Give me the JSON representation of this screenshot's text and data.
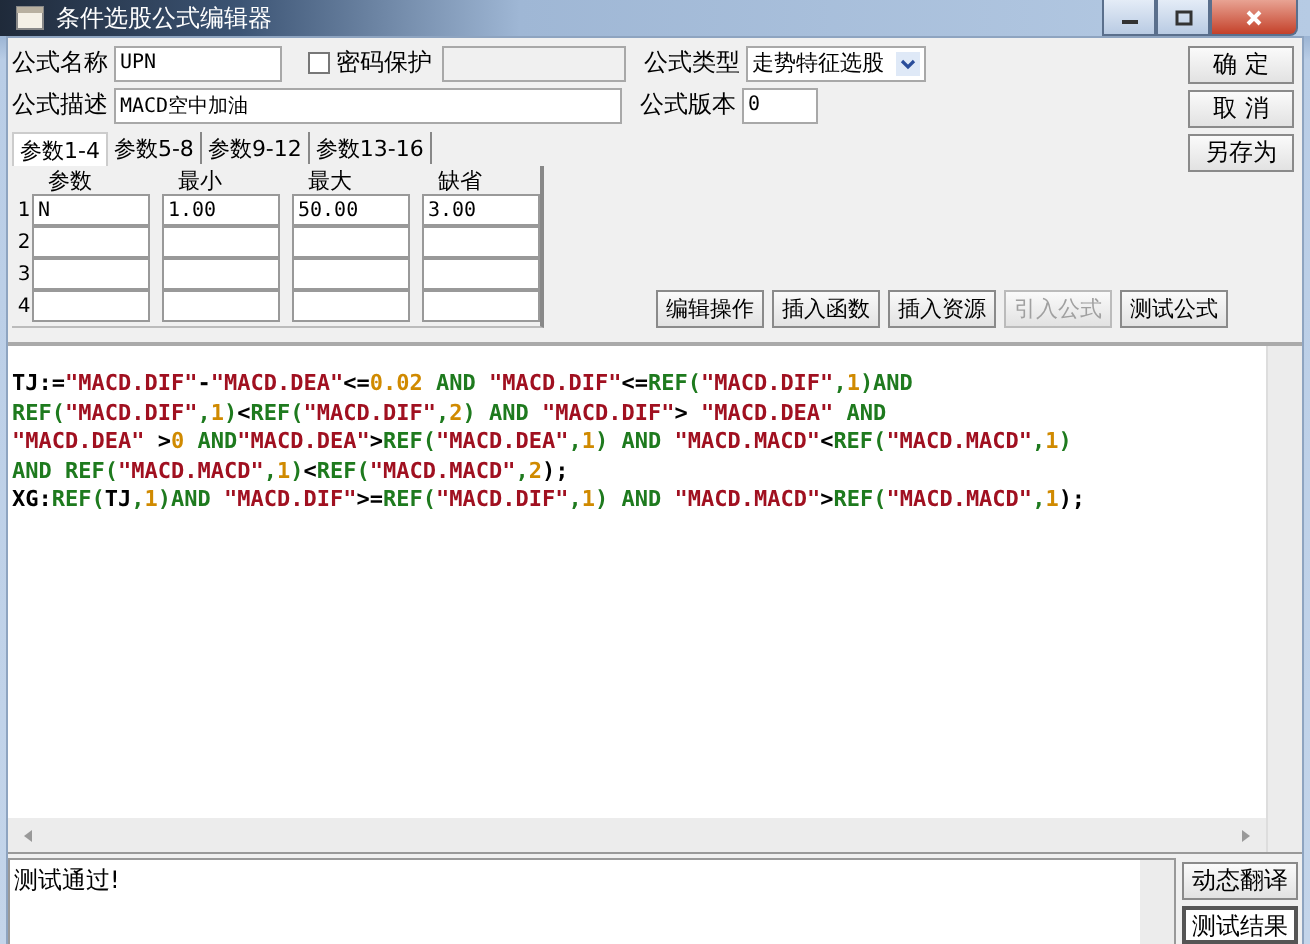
{
  "window": {
    "title": "条件选股公式编辑器"
  },
  "form": {
    "name_label": "公式名称",
    "name": "UPN",
    "password": {
      "label": "密码保护",
      "checked": false
    },
    "type_label": "公式类型",
    "type": "走势特征选股",
    "desc_label": "公式描述",
    "desc": "MACD空中加油",
    "version_label": "公式版本",
    "version": "0"
  },
  "side_buttons": [
    "确 定",
    "取 消",
    "另存为"
  ],
  "param_tabs": [
    {
      "label": "参数1-4",
      "selected": true
    },
    {
      "label": "参数5-8",
      "selected": false
    },
    {
      "label": "参数9-12",
      "selected": false
    },
    {
      "label": "参数13-16",
      "selected": false
    }
  ],
  "params": {
    "columns": [
      "参数",
      "最小",
      "最大",
      "缺省"
    ],
    "rows": [
      {
        "index": "1",
        "values": [
          "N",
          "1.00",
          "50.00",
          "3.00"
        ]
      },
      {
        "index": "2"
      },
      {
        "index": "3"
      },
      {
        "index": "4"
      }
    ]
  },
  "tool_buttons": [
    {
      "label": "编辑操作",
      "disabled": false
    },
    {
      "label": "插入函数",
      "disabled": false
    },
    {
      "label": "插入资源",
      "disabled": false
    },
    {
      "label": "引入公式",
      "disabled": true
    },
    {
      "label": "测试公式",
      "disabled": false
    }
  ],
  "code_lines": [
    [
      {
        "kind": "plain",
        "text": "TJ:="
      },
      {
        "kind": "str",
        "text": "\"MACD.DIF\""
      },
      {
        "kind": "plain",
        "text": "-"
      },
      {
        "kind": "str",
        "text": "\"MACD.DEA\""
      },
      {
        "kind": "plain",
        "text": "<="
      },
      {
        "kind": "num",
        "text": "0.02"
      },
      {
        "kind": "kw",
        "text": " AND "
      },
      {
        "kind": "str",
        "text": "\"MACD.DIF\""
      },
      {
        "kind": "plain",
        "text": "<="
      },
      {
        "kind": "kw",
        "text": "REF("
      },
      {
        "kind": "str",
        "text": "\"MACD.DIF\""
      },
      {
        "kind": "kw",
        "text": ","
      },
      {
        "kind": "num",
        "text": "1"
      },
      {
        "kind": "kw",
        "text": ")AND"
      }
    ],
    [
      {
        "kind": "kw",
        "text": "REF("
      },
      {
        "kind": "str",
        "text": "\"MACD.DIF\""
      },
      {
        "kind": "kw",
        "text": ","
      },
      {
        "kind": "num",
        "text": "1"
      },
      {
        "kind": "kw",
        "text": ")"
      },
      {
        "kind": "plain",
        "text": "<"
      },
      {
        "kind": "kw",
        "text": "REF("
      },
      {
        "kind": "str",
        "text": "\"MACD.DIF\""
      },
      {
        "kind": "kw",
        "text": ","
      },
      {
        "kind": "num",
        "text": "2"
      },
      {
        "kind": "kw",
        "text": ") AND "
      },
      {
        "kind": "str",
        "text": "\"MACD.DIF\""
      },
      {
        "kind": "plain",
        "text": "> "
      },
      {
        "kind": "str",
        "text": "\"MACD.DEA\""
      },
      {
        "kind": "kw",
        "text": " AND"
      }
    ],
    [
      {
        "kind": "str",
        "text": "\"MACD.DEA\""
      },
      {
        "kind": "plain",
        "text": " >"
      },
      {
        "kind": "num",
        "text": "0"
      },
      {
        "kind": "kw",
        "text": " AND"
      },
      {
        "kind": "str",
        "text": "\"MACD.DEA\""
      },
      {
        "kind": "plain",
        "text": ">"
      },
      {
        "kind": "kw",
        "text": "REF("
      },
      {
        "kind": "str",
        "text": "\"MACD.DEA\""
      },
      {
        "kind": "kw",
        "text": ","
      },
      {
        "kind": "num",
        "text": "1"
      },
      {
        "kind": "kw",
        "text": ") AND "
      },
      {
        "kind": "str",
        "text": "\"MACD.MACD\""
      },
      {
        "kind": "plain",
        "text": "<"
      },
      {
        "kind": "kw",
        "text": "REF("
      },
      {
        "kind": "str",
        "text": "\"MACD.MACD\""
      },
      {
        "kind": "kw",
        "text": ","
      },
      {
        "kind": "num",
        "text": "1"
      },
      {
        "kind": "kw",
        "text": ")"
      }
    ],
    [
      {
        "kind": "kw",
        "text": "AND REF("
      },
      {
        "kind": "str",
        "text": "\"MACD.MACD\""
      },
      {
        "kind": "kw",
        "text": ","
      },
      {
        "kind": "num",
        "text": "1"
      },
      {
        "kind": "kw",
        "text": ")"
      },
      {
        "kind": "plain",
        "text": "<"
      },
      {
        "kind": "kw",
        "text": "REF("
      },
      {
        "kind": "str",
        "text": "\"MACD.MACD\""
      },
      {
        "kind": "kw",
        "text": ","
      },
      {
        "kind": "num",
        "text": "2"
      },
      {
        "kind": "plain",
        "text": ");"
      }
    ],
    [
      {
        "kind": "plain",
        "text": "XG:"
      },
      {
        "kind": "kw",
        "text": "REF("
      },
      {
        "kind": "plain",
        "text": "TJ"
      },
      {
        "kind": "kw",
        "text": ","
      },
      {
        "kind": "num",
        "text": "1"
      },
      {
        "kind": "kw",
        "text": ")AND "
      },
      {
        "kind": "str",
        "text": "\"MACD.DIF\""
      },
      {
        "kind": "plain",
        "text": ">="
      },
      {
        "kind": "kw",
        "text": "REF("
      },
      {
        "kind": "str",
        "text": "\"MACD.DIF\""
      },
      {
        "kind": "kw",
        "text": ","
      },
      {
        "kind": "num",
        "text": "1"
      },
      {
        "kind": "kw",
        "text": ") AND "
      },
      {
        "kind": "str",
        "text": "\"MACD.MACD\""
      },
      {
        "kind": "plain",
        "text": ">"
      },
      {
        "kind": "kw",
        "text": "REF("
      },
      {
        "kind": "str",
        "text": "\"MACD.MACD\""
      },
      {
        "kind": "kw",
        "text": ","
      },
      {
        "kind": "num",
        "text": "1"
      },
      {
        "kind": "plain",
        "text": ");"
      }
    ]
  ],
  "output": {
    "text": "测试通过!"
  },
  "result_buttons": [
    {
      "label": "动态翻译",
      "selected": false
    },
    {
      "label": "测试结果",
      "selected": true
    }
  ]
}
